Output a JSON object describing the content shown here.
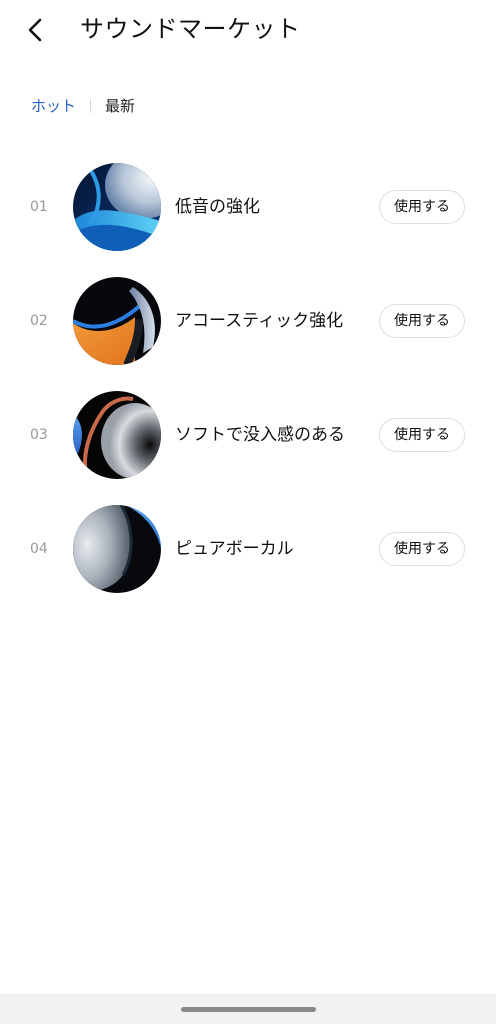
{
  "header": {
    "title": "サウンドマーケット",
    "back_icon": "chevron-left-icon"
  },
  "tabs": [
    {
      "label": "ホット",
      "active": true
    },
    {
      "label": "最新",
      "active": false
    }
  ],
  "items": [
    {
      "index": "01",
      "title": "低音の強化",
      "button": "使用する"
    },
    {
      "index": "02",
      "title": "アコースティック強化",
      "button": "使用する"
    },
    {
      "index": "03",
      "title": "ソフトで没入感のある",
      "button": "使用する"
    },
    {
      "index": "04",
      "title": "ピュアボーカル",
      "button": "使用する"
    }
  ],
  "colors": {
    "accent": "#2a63c8",
    "index_text": "#9a9a9a",
    "button_border": "#dedede",
    "nav_bar": "#f2f2f2"
  }
}
